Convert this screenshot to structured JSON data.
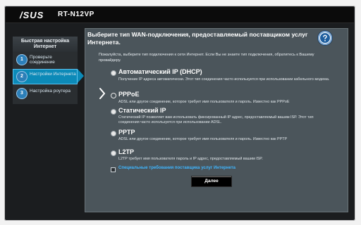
{
  "header": {
    "brand": "/SUS",
    "model": "RT-N12VP"
  },
  "sidebar": {
    "title": "Быстрая настройка Интернет",
    "items": [
      {
        "num": "1",
        "label": "Проверьте соединение",
        "active": false
      },
      {
        "num": "2",
        "label": "Настройки Интернета",
        "active": true
      },
      {
        "num": "3",
        "label": "Настройка роутера",
        "active": false
      }
    ]
  },
  "main": {
    "title": "Выберите тип WAN-подключения, предоставляемый поставщиком услуг Интернета.",
    "description": "Пожалуйста, выберите тип подключения к сети Интернет. Если Вы не знаете тип подключения, обратитесь к Вашему провайдеру.",
    "options": [
      {
        "title": "Автоматический IP (DHCP)",
        "desc": "Получение IP адреса автоматически. Этот тип соединения часто используется при использовании кабельного модема.",
        "selected": false
      },
      {
        "title": "PPPoE",
        "desc": "ADSL или другое соединение, которое требует имя пользователя и пароль. Известно как PPPoE",
        "selected": true
      },
      {
        "title": "Статический IP",
        "desc": "Статический IP позволяет вам использовать фиксированный IP адрес, предоставляемый вашим ISP. Этот тип соединения часто используется при использовании ADSL.",
        "selected": false
      },
      {
        "title": "PPTP",
        "desc": "ADSL или другое соединение, которое требует имя пользователя и пароль. Известно как PPTP",
        "selected": false
      },
      {
        "title": "L2TP",
        "desc": "L2TP требует имя пользователя пароль и IP адрес, предоставляемый вашим ISP.",
        "selected": false
      }
    ],
    "special_requirements": "Специальные требования поставщика услуг Интернета",
    "next_label": "Далее"
  },
  "colors": {
    "accent": "#0c8ab8",
    "link": "#3fb6ff",
    "panel": "#4b555b"
  },
  "icons": {
    "help": "help-question-icon",
    "selection": "chevron-right-icon"
  }
}
